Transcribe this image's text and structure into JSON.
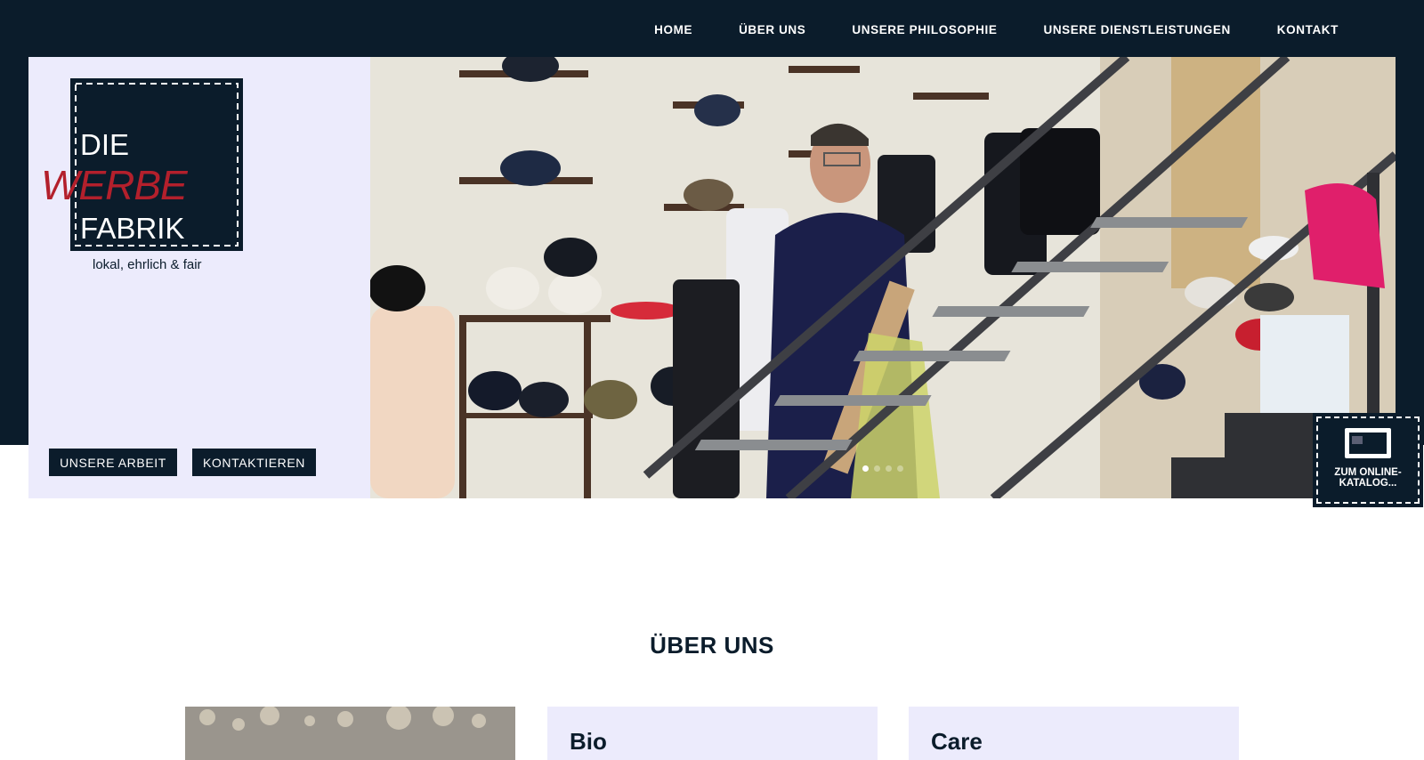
{
  "nav": {
    "items": [
      {
        "label": "HOME"
      },
      {
        "label": "ÜBER UNS"
      },
      {
        "label": "UNSERE PHILOSOPHIE"
      },
      {
        "label": "UNSERE DIENSTLEISTUNGEN"
      },
      {
        "label": "KONTAKT"
      }
    ]
  },
  "logo": {
    "line1": "DIE",
    "line2": "WERBE",
    "line3": "FABRIK",
    "tagline": "lokal, ehrlich & fair"
  },
  "hero": {
    "buttons": {
      "arbeit": "UNSERE ARBEIT",
      "kontakt": "KONTAKTIEREN"
    },
    "slides": 4,
    "active_slide": 1
  },
  "catalog": {
    "label": "ZUM ONLINE-KATALOG..."
  },
  "about": {
    "title": "ÜBER UNS",
    "cards": [
      {
        "title": "Bio"
      },
      {
        "title": "Care"
      }
    ]
  },
  "colors": {
    "navy": "#0b1c2b",
    "lavender": "#ecebfc",
    "logo_red": "#b3202c"
  },
  "icons": {
    "catalog": "monitor-icon"
  }
}
